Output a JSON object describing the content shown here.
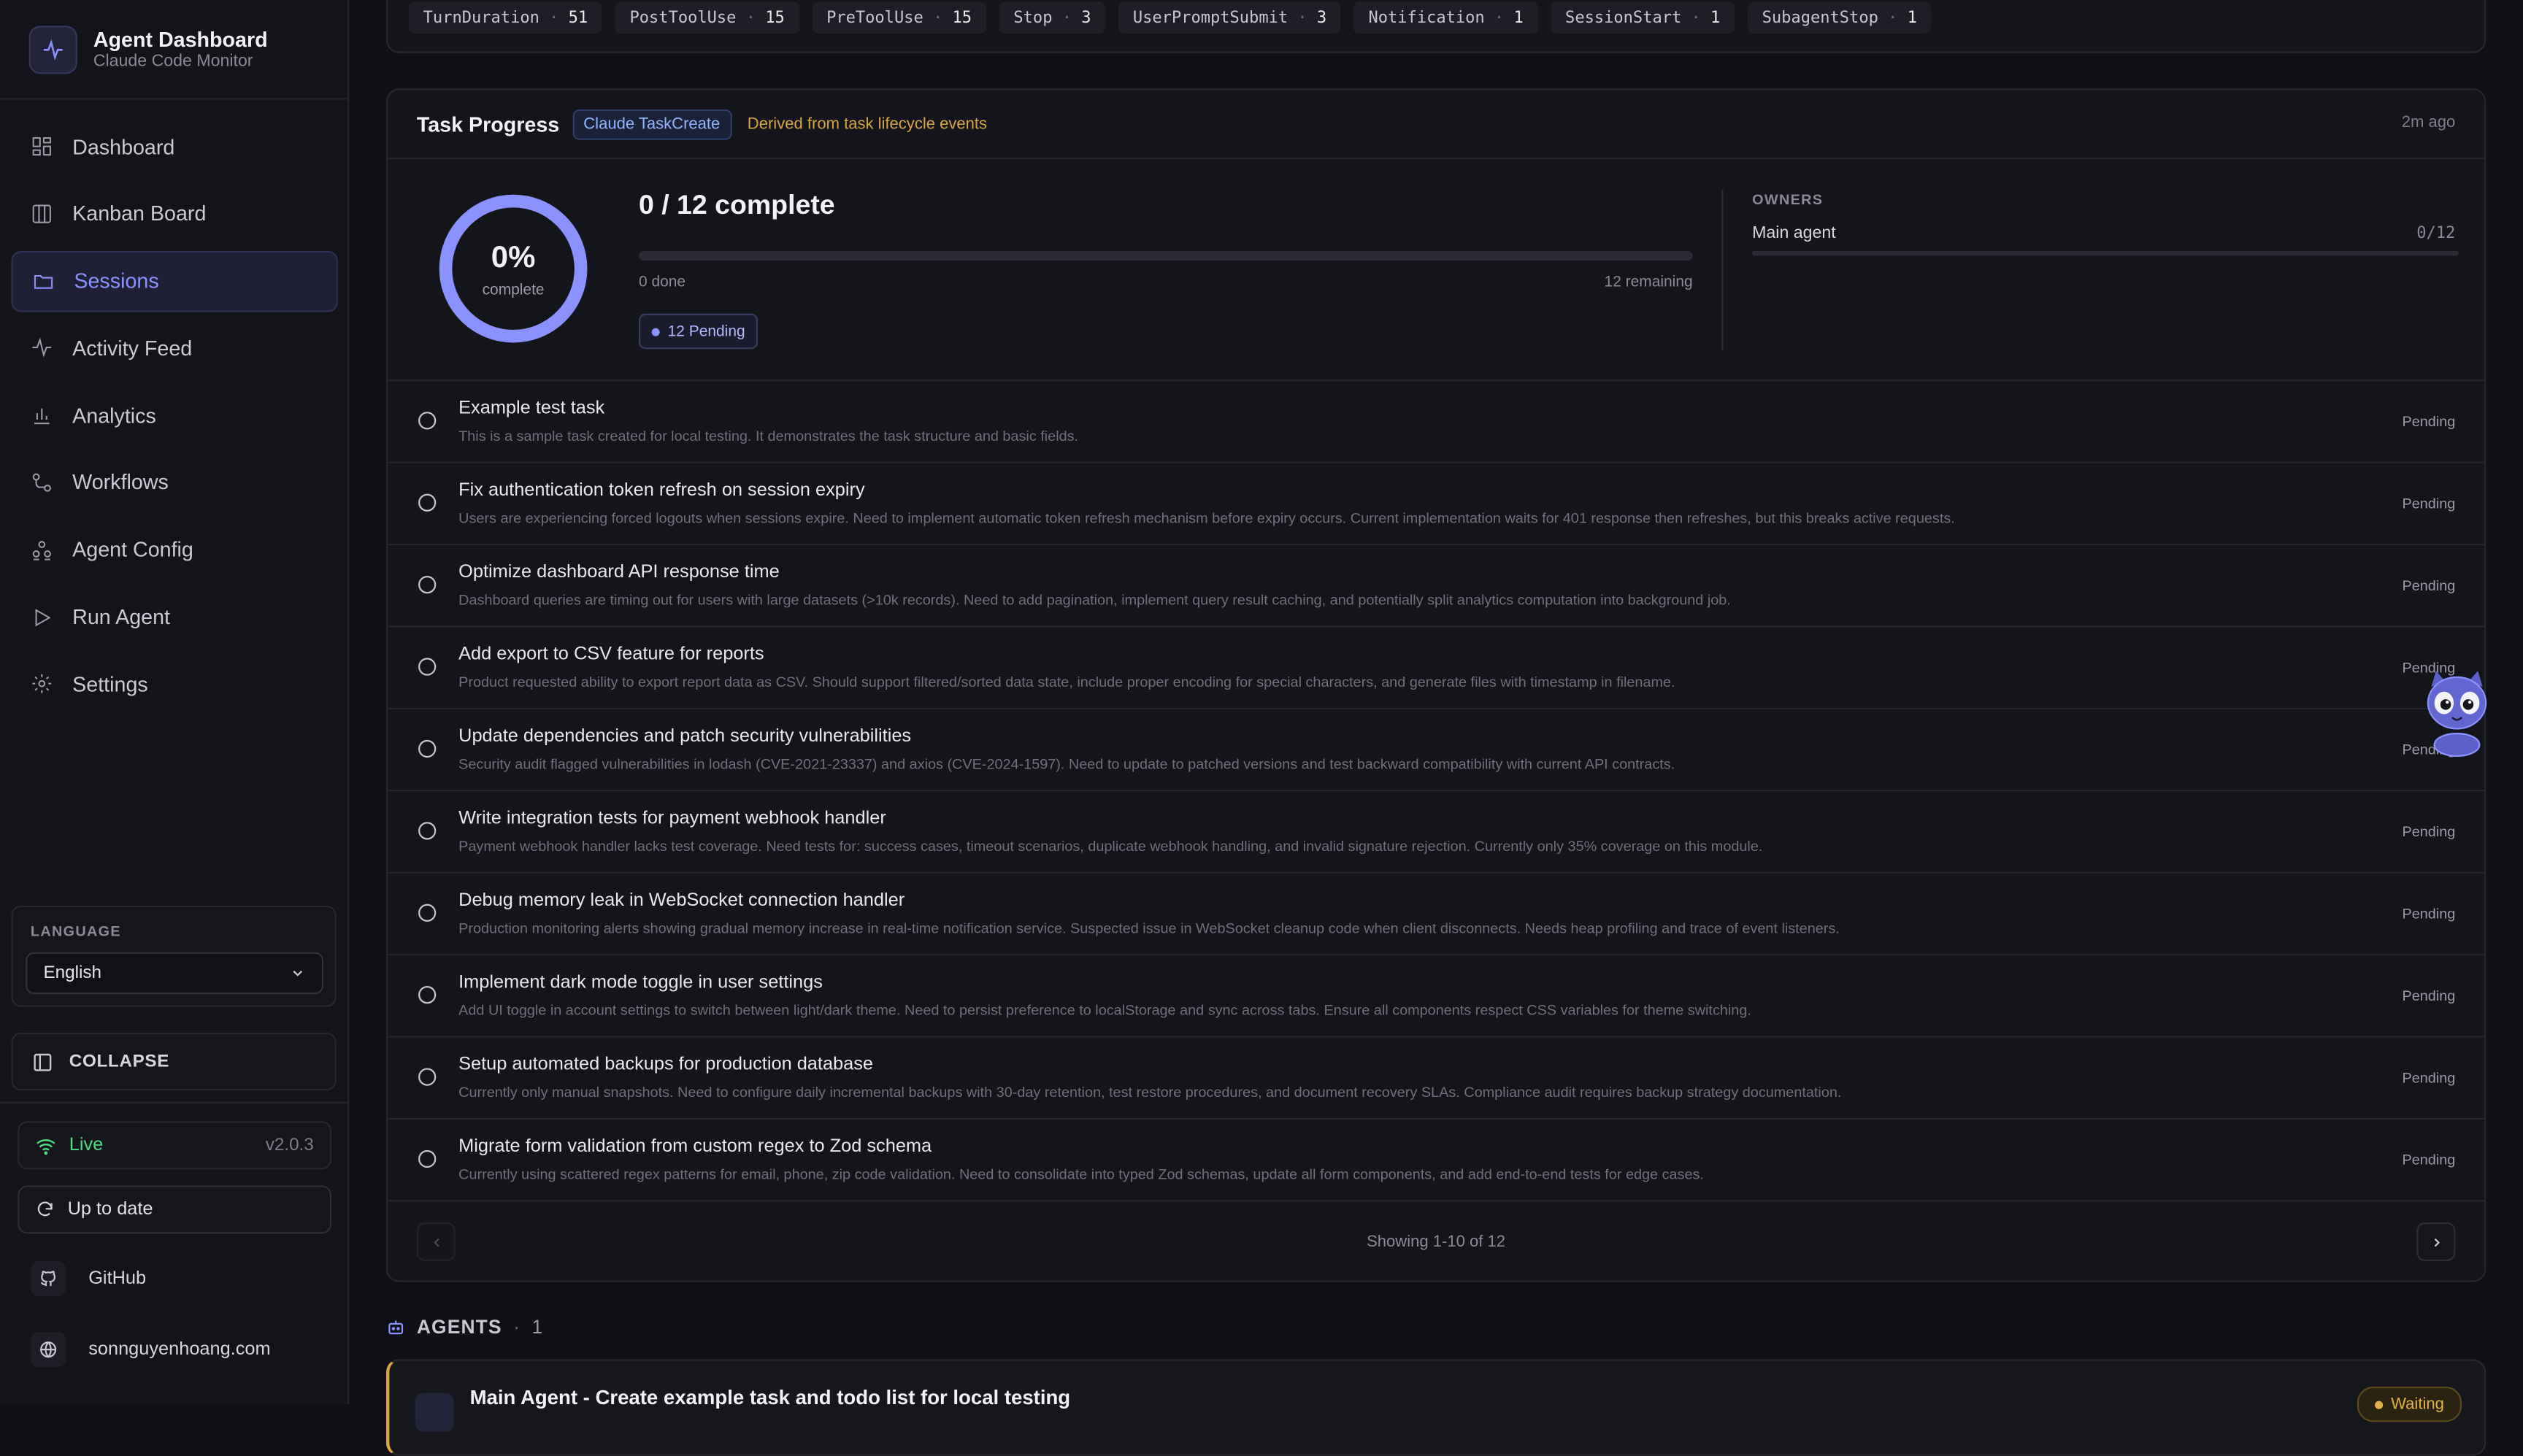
{
  "sidebar": {
    "app_title": "Agent Dashboard",
    "app_subtitle": "Claude Code Monitor",
    "nav": [
      {
        "label": "Dashboard",
        "icon": "grid-icon"
      },
      {
        "label": "Kanban Board",
        "icon": "columns-icon"
      },
      {
        "label": "Sessions",
        "icon": "folder-icon"
      },
      {
        "label": "Activity Feed",
        "icon": "pulse-icon"
      },
      {
        "label": "Analytics",
        "icon": "bar-chart-icon"
      },
      {
        "label": "Workflows",
        "icon": "workflow-icon"
      },
      {
        "label": "Agent Config",
        "icon": "agents-icon"
      },
      {
        "label": "Run Agent",
        "icon": "play-icon"
      },
      {
        "label": "Settings",
        "icon": "gear-icon"
      }
    ],
    "active_nav": "Sessions",
    "language_label": "LANGUAGE",
    "language_value": "English",
    "collapse_label": "COLLAPSE",
    "live_label": "Live",
    "version": "v2.0.3",
    "update_label": "Up to date",
    "github_label": "GitHub",
    "website_label": "sonnguyenhoang.com"
  },
  "hooks": [
    {
      "name": "TurnDuration",
      "count": "51"
    },
    {
      "name": "PostToolUse",
      "count": "15"
    },
    {
      "name": "PreToolUse",
      "count": "15"
    },
    {
      "name": "Stop",
      "count": "3"
    },
    {
      "name": "UserPromptSubmit",
      "count": "3"
    },
    {
      "name": "Notification",
      "count": "1"
    },
    {
      "name": "SessionStart",
      "count": "1"
    },
    {
      "name": "SubagentStop",
      "count": "1"
    }
  ],
  "task_progress": {
    "title": "Task Progress",
    "badge": "Claude TaskCreate",
    "derived_note": "Derived from task lifecycle events",
    "updated": "2m ago",
    "percent_label": "0%",
    "percent_value": 0,
    "complete_word": "complete",
    "summary": "0 / 12 complete",
    "done_text": "0 done",
    "remaining_text": "12 remaining",
    "pending_chip": "12 Pending",
    "owners_label": "OWNERS",
    "owner_name": "Main agent",
    "owner_count": "0/12"
  },
  "tasks": [
    {
      "title": "Example test task",
      "desc": "This is a sample task created for local testing. It demonstrates the task structure and basic fields.",
      "status": "Pending"
    },
    {
      "title": "Fix authentication token refresh on session expiry",
      "desc": "Users are experiencing forced logouts when sessions expire. Need to implement automatic token refresh mechanism before expiry occurs. Current implementation waits for 401 response then refreshes, but this breaks active requests.",
      "status": "Pending"
    },
    {
      "title": "Optimize dashboard API response time",
      "desc": "Dashboard queries are timing out for users with large datasets (>10k records). Need to add pagination, implement query result caching, and potentially split analytics computation into background job.",
      "status": "Pending"
    },
    {
      "title": "Add export to CSV feature for reports",
      "desc": "Product requested ability to export report data as CSV. Should support filtered/sorted data state, include proper encoding for special characters, and generate files with timestamp in filename.",
      "status": "Pending"
    },
    {
      "title": "Update dependencies and patch security vulnerabilities",
      "desc": "Security audit flagged vulnerabilities in lodash (CVE-2021-23337) and axios (CVE-2024-1597). Need to update to patched versions and test backward compatibility with current API contracts.",
      "status": "Pending"
    },
    {
      "title": "Write integration tests for payment webhook handler",
      "desc": "Payment webhook handler lacks test coverage. Need tests for: success cases, timeout scenarios, duplicate webhook handling, and invalid signature rejection. Currently only 35% coverage on this module.",
      "status": "Pending"
    },
    {
      "title": "Debug memory leak in WebSocket connection handler",
      "desc": "Production monitoring alerts showing gradual memory increase in real-time notification service. Suspected issue in WebSocket cleanup code when client disconnects. Needs heap profiling and trace of event listeners.",
      "status": "Pending"
    },
    {
      "title": "Implement dark mode toggle in user settings",
      "desc": "Add UI toggle in account settings to switch between light/dark theme. Need to persist preference to localStorage and sync across tabs. Ensure all components respect CSS variables for theme switching.",
      "status": "Pending"
    },
    {
      "title": "Setup automated backups for production database",
      "desc": "Currently only manual snapshots. Need to configure daily incremental backups with 30-day retention, test restore procedures, and document recovery SLAs. Compliance audit requires backup strategy documentation.",
      "status": "Pending"
    },
    {
      "title": "Migrate form validation from custom regex to Zod schema",
      "desc": "Currently using scattered regex patterns for email, phone, zip code validation. Need to consolidate into typed Zod schemas, update all form components, and add end-to-end tests for edge cases.",
      "status": "Pending"
    }
  ],
  "pagination": {
    "text": "Showing 1-10 of 12"
  },
  "agents": {
    "header": "AGENTS",
    "count": "1",
    "card_title": "Main Agent - Create example task and todo list for local testing",
    "card_status": "Waiting"
  },
  "colors": {
    "accent": "#8b92ff",
    "live": "#4ade80",
    "warning": "#d8a640"
  }
}
